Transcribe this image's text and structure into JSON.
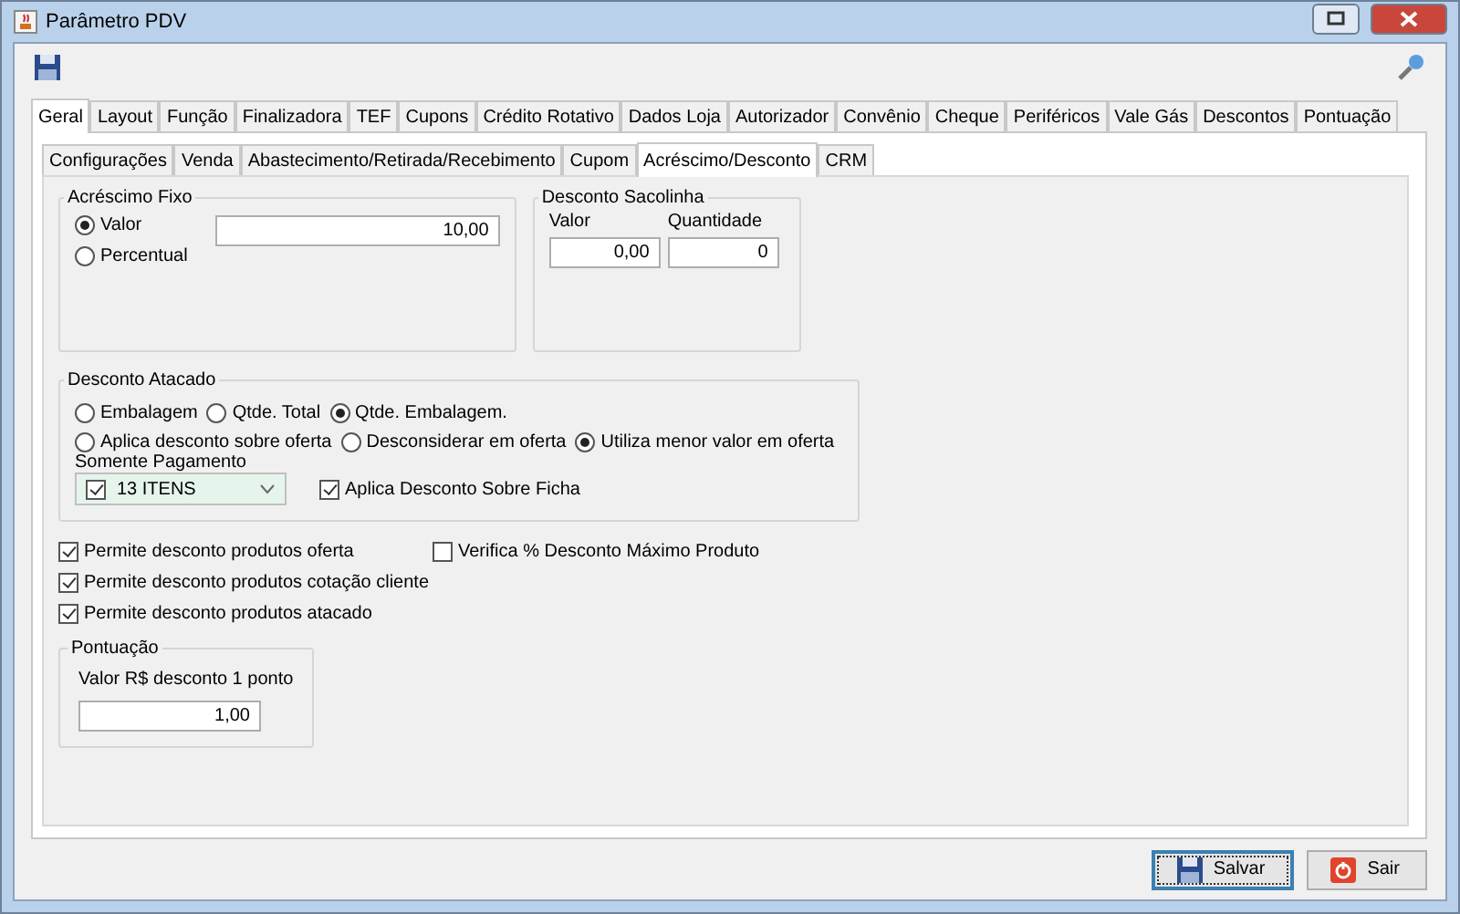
{
  "window": {
    "title": "Parâmetro PDV"
  },
  "main_tabs": [
    {
      "label": "Geral",
      "selected": true
    },
    {
      "label": "Layout",
      "selected": false
    },
    {
      "label": "Função",
      "selected": false
    },
    {
      "label": "Finalizadora",
      "selected": false
    },
    {
      "label": "TEF",
      "selected": false
    },
    {
      "label": "Cupons",
      "selected": false
    },
    {
      "label": "Crédito Rotativo",
      "selected": false
    },
    {
      "label": "Dados Loja",
      "selected": false
    },
    {
      "label": "Autorizador",
      "selected": false
    },
    {
      "label": "Convênio",
      "selected": false
    },
    {
      "label": "Cheque",
      "selected": false
    },
    {
      "label": "Periféricos",
      "selected": false
    },
    {
      "label": "Vale Gás",
      "selected": false
    },
    {
      "label": "Descontos",
      "selected": false
    },
    {
      "label": "Pontuação",
      "selected": false
    }
  ],
  "sub_tabs": [
    {
      "label": "Configurações",
      "selected": false
    },
    {
      "label": "Venda",
      "selected": false
    },
    {
      "label": "Abastecimento/Retirada/Recebimento",
      "selected": false
    },
    {
      "label": "Cupom",
      "selected": false
    },
    {
      "label": "Acréscimo/Desconto",
      "selected": true
    },
    {
      "label": "CRM",
      "selected": false
    }
  ],
  "acrescimo_fixo": {
    "title": "Acréscimo Fixo",
    "options": [
      {
        "label": "Valor",
        "selected": true
      },
      {
        "label": "Percentual",
        "selected": false
      }
    ],
    "value": "10,00"
  },
  "desconto_sacolinha": {
    "title": "Desconto Sacolinha",
    "fields": [
      {
        "label": "Valor",
        "value": "0,00"
      },
      {
        "label": "Quantidade",
        "value": "0"
      }
    ]
  },
  "desconto_atacado": {
    "title": "Desconto Atacado",
    "radio_rows": [
      [
        {
          "label": "Embalagem",
          "selected": false
        },
        {
          "label": "Qtde. Total",
          "selected": false
        },
        {
          "label": "Qtde. Embalagem.",
          "selected": true
        }
      ],
      [
        {
          "label": "Aplica desconto sobre oferta",
          "selected": false
        },
        {
          "label": "Desconsiderar em oferta",
          "selected": false
        },
        {
          "label": "Utiliza menor valor em oferta",
          "selected": true
        }
      ]
    ],
    "somente_pagamento": {
      "label": "Somente Pagamento",
      "value": "13 ITENS",
      "checked": true
    },
    "aplica_ficha": {
      "label": "Aplica Desconto Sobre Ficha",
      "checked": true
    }
  },
  "checkboxes_left": [
    {
      "label": "Permite desconto produtos oferta",
      "checked": true
    },
    {
      "label": "Permite desconto produtos cotação cliente",
      "checked": true
    },
    {
      "label": "Permite desconto produtos atacado",
      "checked": true
    }
  ],
  "checkboxes_right": [
    {
      "label": "Verifica % Desconto Máximo Produto",
      "checked": false
    }
  ],
  "pontuacao": {
    "title": "Pontuação",
    "label": "Valor R$ desconto 1 ponto",
    "value": "1,00"
  },
  "buttons": [
    {
      "label": "Salvar",
      "kind": "save",
      "focused": true
    },
    {
      "label": "Sair",
      "kind": "exit",
      "focused": false
    }
  ]
}
